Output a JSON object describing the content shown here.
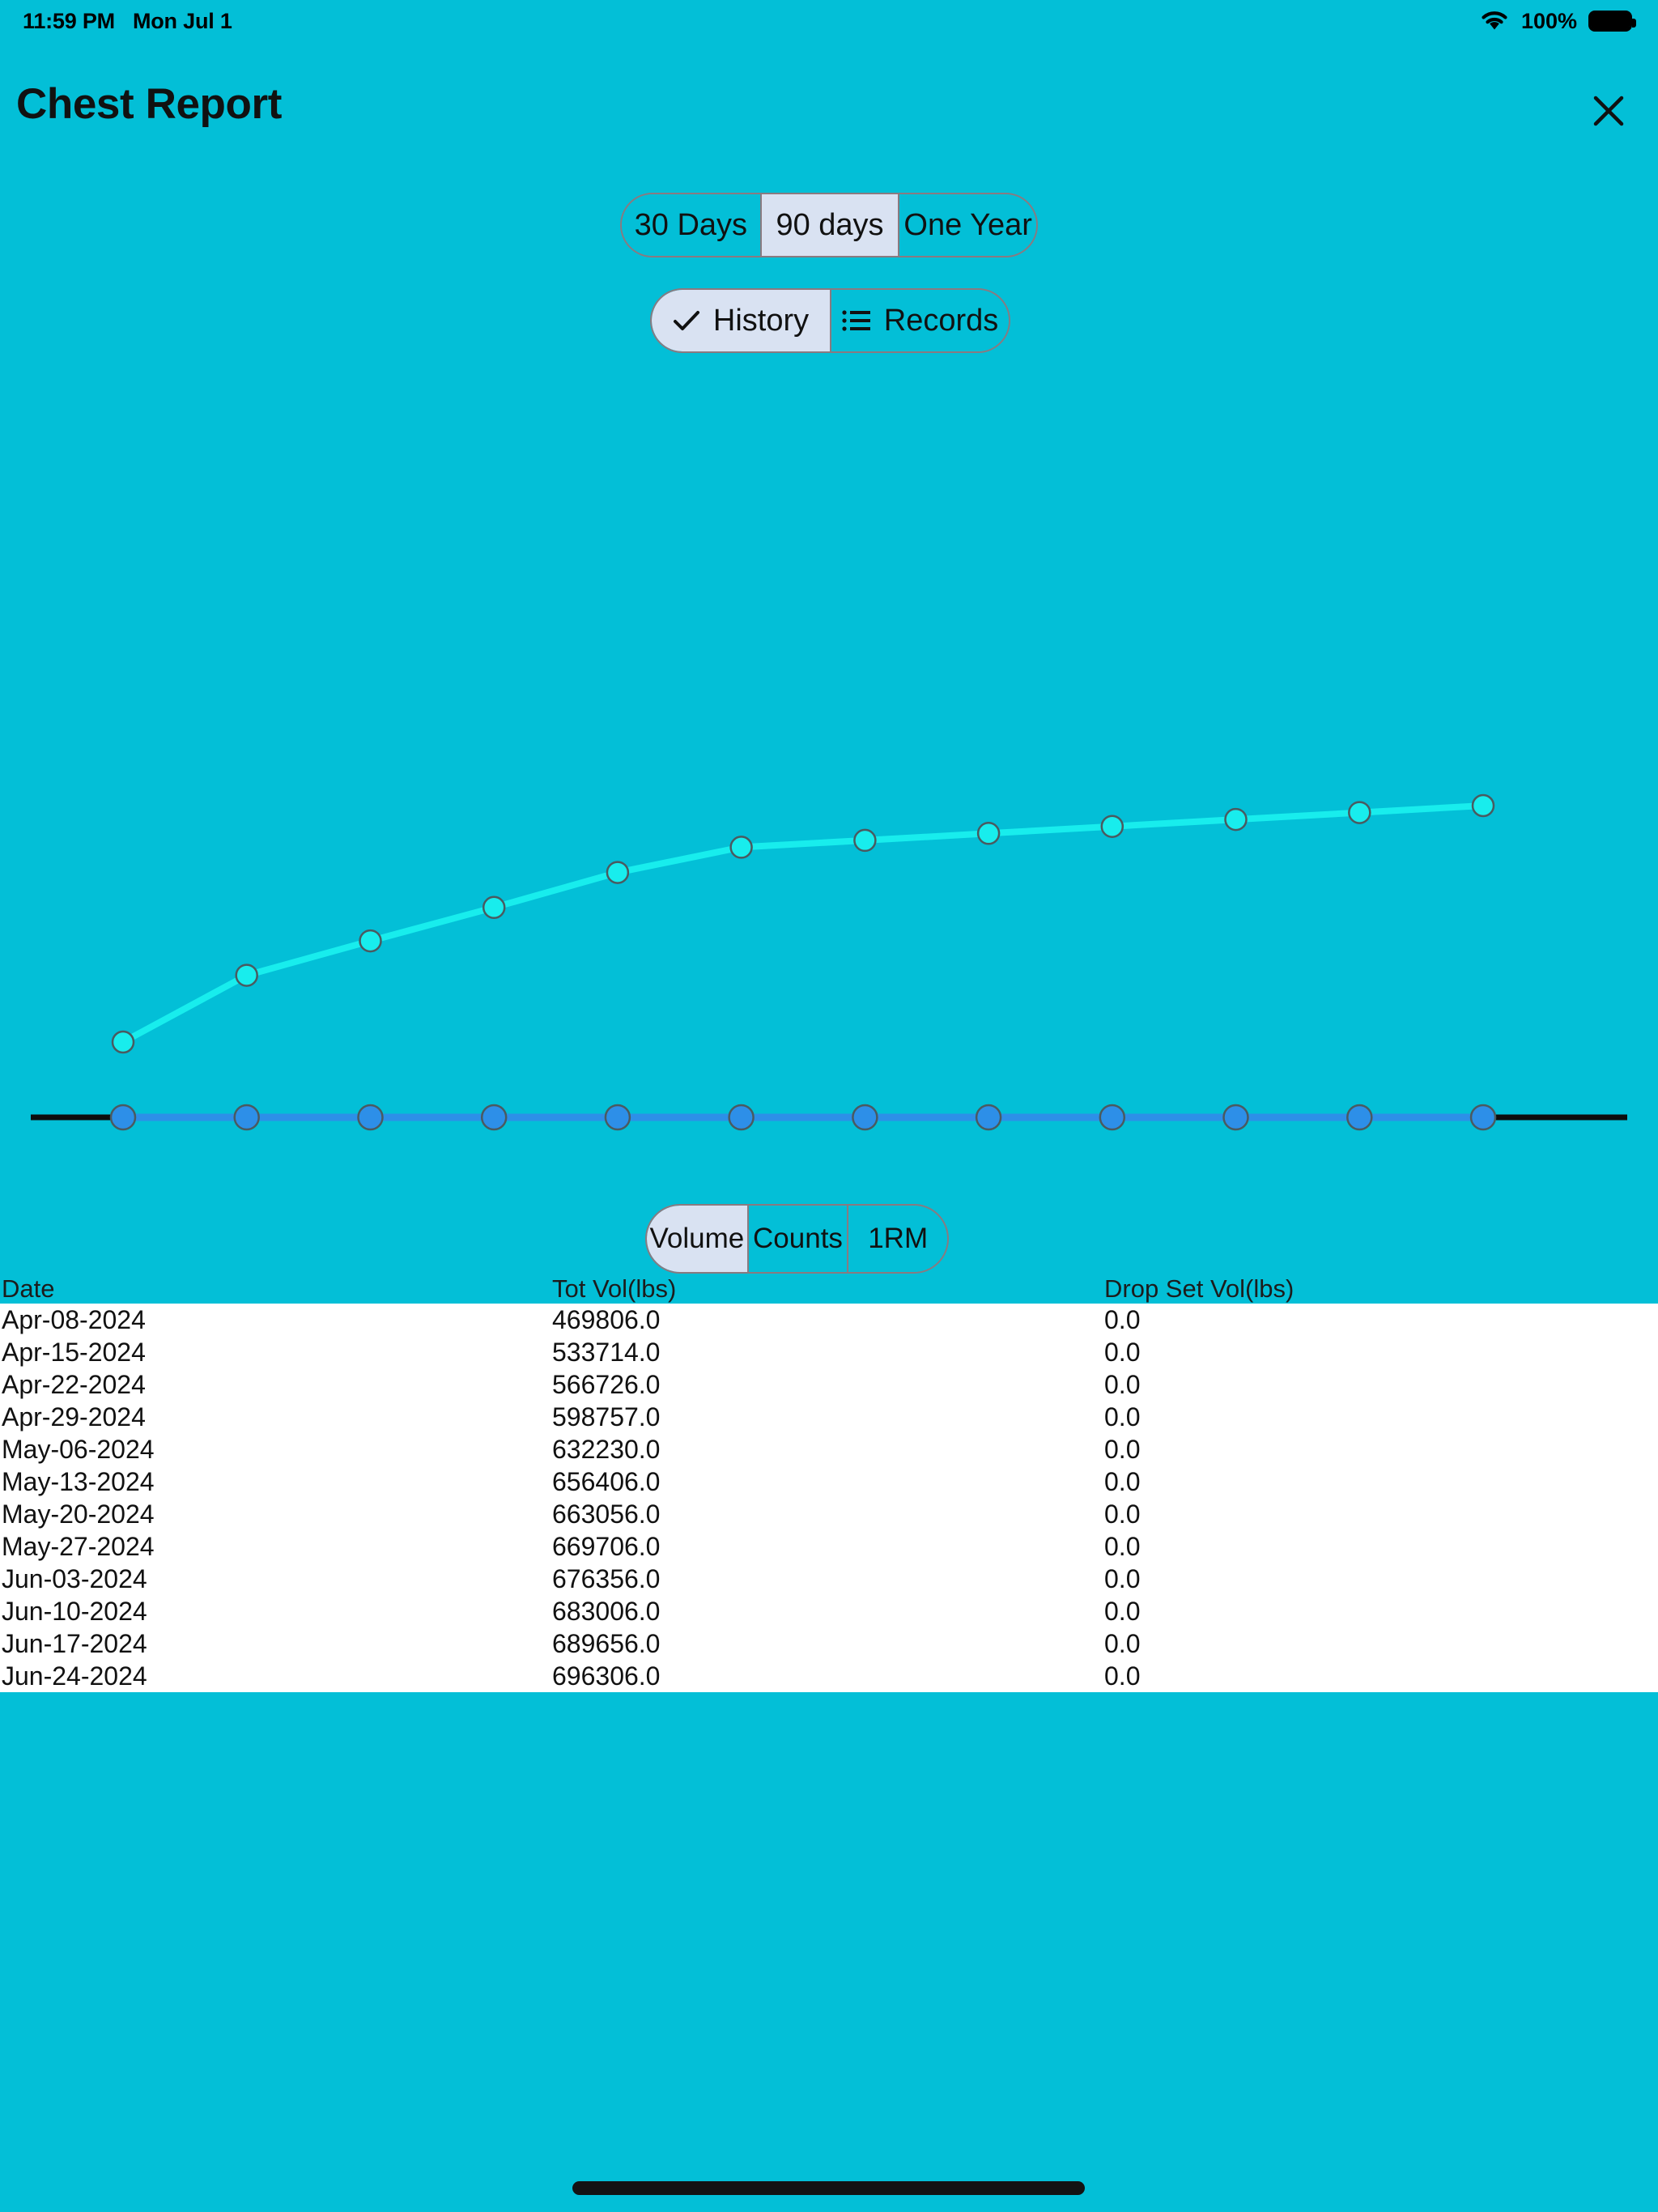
{
  "status_bar": {
    "time": "11:59 PM",
    "date": "Mon Jul 1",
    "battery_percent": "100%",
    "wifi_icon": "wifi-icon",
    "battery_icon": "battery-full-icon"
  },
  "header": {
    "title": "Chest Report",
    "close_icon": "close-icon"
  },
  "range_tabs": {
    "options": [
      "30 Days",
      "90 days",
      "One Year"
    ],
    "selected": "90 days"
  },
  "view_tabs": {
    "options": [
      "History",
      "Records"
    ],
    "selected": "History",
    "history_icon": "check-icon",
    "records_icon": "list-icon"
  },
  "metric_tabs": {
    "options": [
      "Volume",
      "Counts",
      "1RM"
    ],
    "selected": "Volume"
  },
  "table": {
    "columns": [
      "Date",
      "Tot Vol(lbs)",
      "Drop Set Vol(lbs)"
    ],
    "rows": [
      [
        "Apr-08-2024",
        "469806.0",
        "0.0"
      ],
      [
        "Apr-15-2024",
        "533714.0",
        "0.0"
      ],
      [
        "Apr-22-2024",
        "566726.0",
        "0.0"
      ],
      [
        "Apr-29-2024",
        "598757.0",
        "0.0"
      ],
      [
        "May-06-2024",
        "632230.0",
        "0.0"
      ],
      [
        "May-13-2024",
        "656406.0",
        "0.0"
      ],
      [
        "May-20-2024",
        "663056.0",
        "0.0"
      ],
      [
        "May-27-2024",
        "669706.0",
        "0.0"
      ],
      [
        "Jun-03-2024",
        "676356.0",
        "0.0"
      ],
      [
        "Jun-10-2024",
        "683006.0",
        "0.0"
      ],
      [
        "Jun-17-2024",
        "689656.0",
        "0.0"
      ],
      [
        "Jun-24-2024",
        "696306.0",
        "0.0"
      ]
    ]
  },
  "colors": {
    "background": "#03BFD7",
    "selected_segment": "#D9E2F2",
    "segment_border": "#8a7a80",
    "volume_line": "#18EDED",
    "dropset_line": "#2D8FE8",
    "axis": "#0D0D0D",
    "table_background": "#FFFFFF"
  },
  "chart_data": {
    "type": "line",
    "title": "",
    "xlabel": "",
    "ylabel": "",
    "grid": false,
    "legend": "none",
    "categories": [
      "Apr-08-2024",
      "Apr-15-2024",
      "Apr-22-2024",
      "Apr-29-2024",
      "May-06-2024",
      "May-13-2024",
      "May-20-2024",
      "May-27-2024",
      "Jun-03-2024",
      "Jun-10-2024",
      "Jun-17-2024",
      "Jun-24-2024"
    ],
    "ylim": [
      0,
      696306
    ],
    "series": [
      {
        "name": "Tot Vol(lbs)",
        "color": "#18EDED",
        "values": [
          469806.0,
          533714.0,
          566726.0,
          598757.0,
          632230.0,
          656406.0,
          663056.0,
          669706.0,
          676356.0,
          683006.0,
          689656.0,
          696306.0
        ]
      },
      {
        "name": "Drop Set Vol(lbs)",
        "color": "#2D8FE8",
        "values": [
          0.0,
          0.0,
          0.0,
          0.0,
          0.0,
          0.0,
          0.0,
          0.0,
          0.0,
          0.0,
          0.0,
          0.0
        ]
      }
    ]
  }
}
